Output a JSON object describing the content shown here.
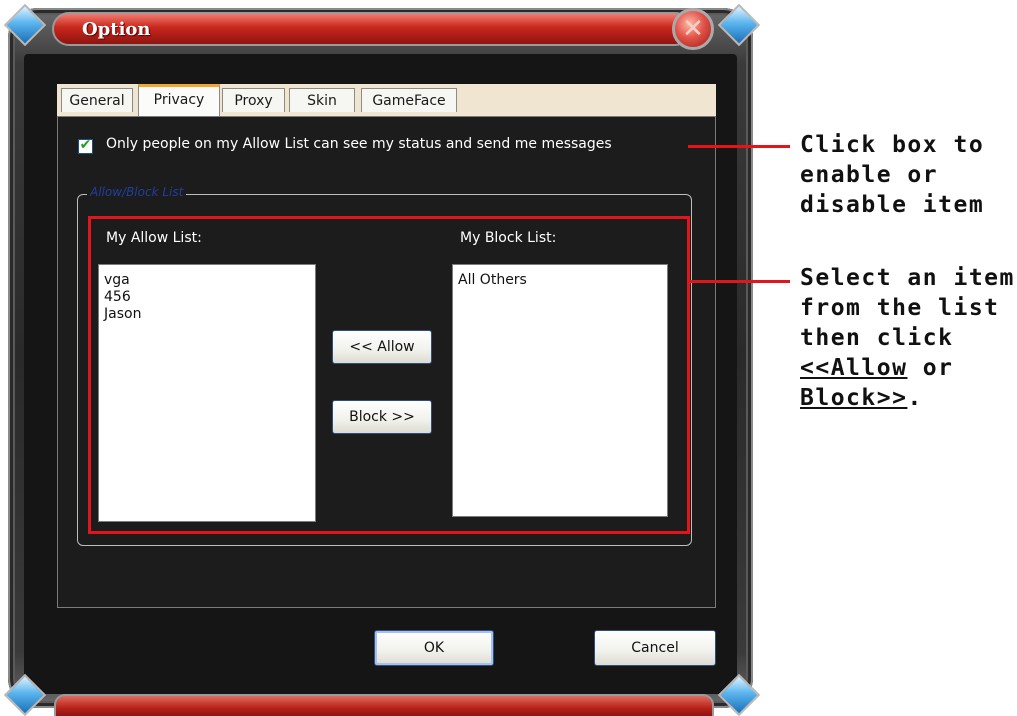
{
  "window": {
    "title": "Option",
    "close_glyph": "✕"
  },
  "tabs": [
    {
      "label": "General",
      "active": false
    },
    {
      "label": "Privacy",
      "active": true
    },
    {
      "label": "Proxy",
      "active": false
    },
    {
      "label": "Skin",
      "active": false
    },
    {
      "label": "GameFace",
      "active": false
    }
  ],
  "privacy": {
    "only_allow_checkbox": {
      "checked": true,
      "label": "Only people on my Allow List can see my status and send me messages"
    },
    "group_title": "Allow/Block List",
    "allow_list": {
      "label": "My Allow List:",
      "items": [
        "vga",
        "456",
        "Jason"
      ]
    },
    "block_list": {
      "label": "My Block List:",
      "items": [
        "All Others"
      ]
    },
    "allow_button": "<< Allow",
    "block_button": "Block >>"
  },
  "footer": {
    "ok_label": "OK",
    "cancel_label": "Cancel"
  },
  "callouts": {
    "checkbox_note": [
      "Click box to",
      "enable or",
      "disable item"
    ],
    "list_note": {
      "line1": "Select an item",
      "line2": "from the list",
      "line3": "then click",
      "allow_link": "<<Allow",
      "or_text": " or",
      "block_link": "Block>>",
      "period": "."
    }
  },
  "colors": {
    "accent_red": "#e2141c",
    "title_red": "#c8261c",
    "check_green": "#21a121",
    "tab_accent": "#f2a734"
  }
}
